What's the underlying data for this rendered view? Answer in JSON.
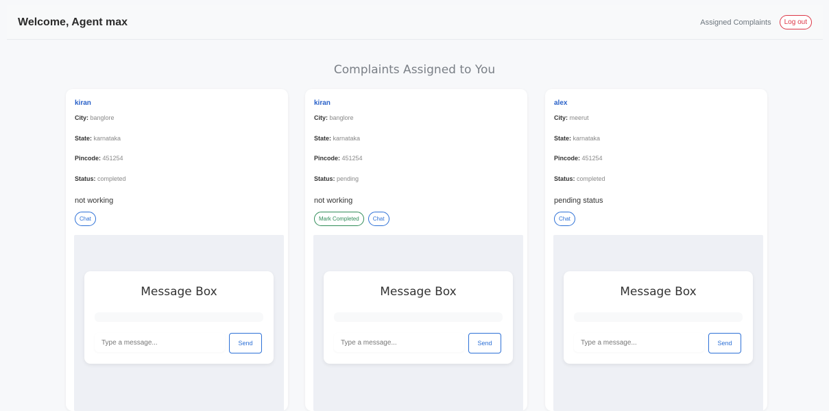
{
  "navbar": {
    "brand": "Welcome, Agent max",
    "assigned_link": "Assigned Complaints",
    "logout_label": "Log out"
  },
  "page": {
    "heading": "Complaints Assigned to You"
  },
  "labels": {
    "city": "City:",
    "state": "State:",
    "pincode": "Pincode:",
    "status": "Status:"
  },
  "complaints": [
    {
      "name": "kiran",
      "city": "banglore",
      "state": "karnataka",
      "pincode": "451254",
      "status": "completed",
      "description": "not working",
      "chat_label": "Chat",
      "message_box": {
        "title": "Message Box",
        "placeholder": "Type a message...",
        "send_label": "Send"
      }
    },
    {
      "name": "kiran",
      "city": "banglore",
      "state": "karnataka",
      "pincode": "451254",
      "status": "pending",
      "description": "not working",
      "mark_completed_label": "Mark Completed",
      "chat_label": "Chat",
      "message_box": {
        "title": "Message Box",
        "placeholder": "Type a message...",
        "send_label": "Send"
      }
    },
    {
      "name": "alex",
      "city": "meerut",
      "state": "karnataka",
      "pincode": "451254",
      "status": "completed",
      "description": "pending status",
      "chat_label": "Chat",
      "message_box": {
        "title": "Message Box",
        "placeholder": "Type a message...",
        "send_label": "Send"
      }
    }
  ]
}
